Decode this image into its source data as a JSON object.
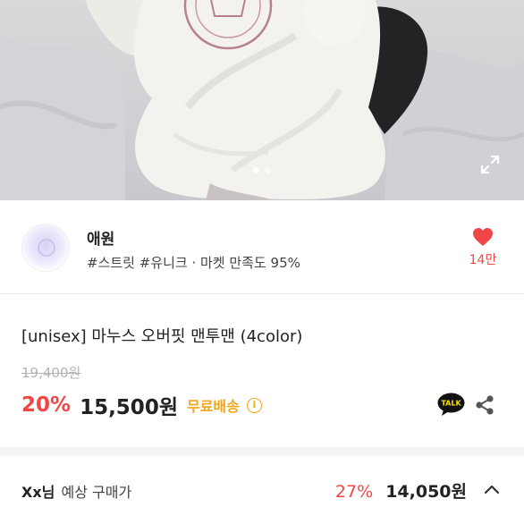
{
  "hero": {
    "active_slide": 0,
    "slide_count": 2
  },
  "seller": {
    "name": "애원",
    "meta": "#스트릿 #유니크 · 마켓 만족도 95%",
    "likes": "14만"
  },
  "product": {
    "title": "[unisex] 마누스 오버핏 맨투맨 (4color)",
    "original_price": "19,400원",
    "discount": "20%",
    "price": "15,500원",
    "shipping": "무료배송",
    "info_icon": "i"
  },
  "expected_price": {
    "user": "Xx님",
    "label": "예상 구매가",
    "discount": "27%",
    "price": "14,050원"
  },
  "colors": {
    "accent_red": "#f04646",
    "shipping_yellow": "#f2a51a",
    "talk_yellow": "#fae100"
  },
  "icons": {
    "expand": "expand-icon",
    "heart": "heart-icon",
    "talk": "kakaotalk-icon",
    "share": "share-icon",
    "chevron": "chevron-up-icon",
    "talk_text": "TALK"
  }
}
